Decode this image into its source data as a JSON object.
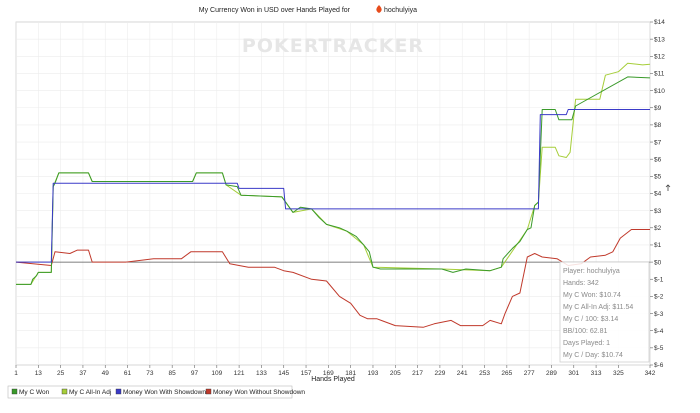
{
  "chart_data": {
    "type": "line",
    "title_text": "My Currency Won in USD over Hands Played for",
    "title_player": "hochulyiya",
    "xlabel": "Hands Played",
    "xlim": [
      1,
      342
    ],
    "xticks": [
      1,
      13,
      25,
      37,
      49,
      61,
      73,
      85,
      97,
      109,
      121,
      133,
      145,
      157,
      169,
      181,
      193,
      205,
      217,
      229,
      241,
      253,
      265,
      277,
      289,
      301,
      313,
      325,
      342
    ],
    "ylim": [
      -6,
      14
    ],
    "yticks": [
      -6,
      -5,
      -4,
      -3,
      -2,
      -1,
      0,
      1,
      2,
      3,
      4,
      5,
      6,
      7,
      8,
      9,
      10,
      11,
      12,
      13,
      14
    ],
    "ytick_labels": [
      "$-6",
      "$-5",
      "$-4",
      "$-3",
      "$-2",
      "$-1",
      "$0",
      "$1",
      "$2",
      "$3",
      "$4",
      "$5",
      "$6",
      "$7",
      "$8",
      "$9",
      "$10",
      "$11",
      "$12",
      "$13",
      "$14"
    ],
    "grid": true,
    "watermark": "POKERTRACKER",
    "series": [
      {
        "name": "My C Won",
        "color": "#3a9a2a",
        "points": [
          [
            1,
            -1.3
          ],
          [
            9,
            -1.3
          ],
          [
            10,
            -1.0
          ],
          [
            12,
            -0.8
          ],
          [
            13,
            -0.6
          ],
          [
            20,
            -0.6
          ],
          [
            21,
            4.4
          ],
          [
            22,
            4.6
          ],
          [
            24,
            5.2
          ],
          [
            40,
            5.2
          ],
          [
            42,
            4.7
          ],
          [
            96,
            4.7
          ],
          [
            98,
            5.2
          ],
          [
            112,
            5.2
          ],
          [
            114,
            4.5
          ],
          [
            120,
            4.4
          ],
          [
            122,
            3.9
          ],
          [
            144,
            3.8
          ],
          [
            146,
            3.5
          ],
          [
            150,
            2.9
          ],
          [
            154,
            3.2
          ],
          [
            160,
            3.1
          ],
          [
            164,
            2.6
          ],
          [
            168,
            2.2
          ],
          [
            175,
            2.0
          ],
          [
            179,
            1.8
          ],
          [
            184,
            1.5
          ],
          [
            188,
            1.0
          ],
          [
            191,
            0.6
          ],
          [
            193,
            -0.3
          ],
          [
            197,
            -0.4
          ],
          [
            230,
            -0.4
          ],
          [
            236,
            -0.6
          ],
          [
            243,
            -0.4
          ],
          [
            256,
            -0.5
          ],
          [
            262,
            -0.3
          ],
          [
            263,
            0.2
          ],
          [
            268,
            0.8
          ],
          [
            272,
            1.2
          ],
          [
            276,
            1.9
          ],
          [
            278,
            2.0
          ],
          [
            280,
            3.3
          ],
          [
            282,
            3.5
          ],
          [
            284,
            8.9
          ],
          [
            291,
            8.9
          ],
          [
            293,
            8.3
          ],
          [
            300,
            8.3
          ],
          [
            302,
            9.1
          ],
          [
            330,
            10.8
          ],
          [
            342,
            10.74
          ]
        ]
      },
      {
        "name": "My C All-In Adj",
        "color": "#a6ce39",
        "points": [
          [
            1,
            -1.3
          ],
          [
            9,
            -1.3
          ],
          [
            13,
            -0.6
          ],
          [
            20,
            -0.6
          ],
          [
            21,
            4.4
          ],
          [
            24,
            5.2
          ],
          [
            40,
            5.2
          ],
          [
            42,
            4.7
          ],
          [
            96,
            4.7
          ],
          [
            98,
            5.2
          ],
          [
            112,
            5.2
          ],
          [
            114,
            4.5
          ],
          [
            122,
            3.9
          ],
          [
            144,
            3.8
          ],
          [
            150,
            2.9
          ],
          [
            160,
            3.1
          ],
          [
            168,
            2.2
          ],
          [
            179,
            1.8
          ],
          [
            188,
            1.0
          ],
          [
            193,
            -0.3
          ],
          [
            230,
            -0.4
          ],
          [
            256,
            -0.5
          ],
          [
            262,
            -0.3
          ],
          [
            276,
            1.9
          ],
          [
            280,
            3.3
          ],
          [
            282,
            3.5
          ],
          [
            284,
            6.7
          ],
          [
            291,
            6.7
          ],
          [
            293,
            6.2
          ],
          [
            297,
            6.1
          ],
          [
            299,
            6.4
          ],
          [
            302,
            9.5
          ],
          [
            315,
            9.5
          ],
          [
            318,
            10.9
          ],
          [
            325,
            11.1
          ],
          [
            330,
            11.6
          ],
          [
            338,
            11.5
          ],
          [
            342,
            11.54
          ]
        ]
      },
      {
        "name": "Money Won With Showdown",
        "color": "#3a3ac8",
        "points": [
          [
            1,
            0
          ],
          [
            20,
            0
          ],
          [
            21,
            4.6
          ],
          [
            120,
            4.6
          ],
          [
            121,
            4.3
          ],
          [
            145,
            4.3
          ],
          [
            146,
            3.1
          ],
          [
            282,
            3.1
          ],
          [
            283,
            8.6
          ],
          [
            297,
            8.6
          ],
          [
            298,
            8.9
          ],
          [
            342,
            8.9
          ]
        ]
      },
      {
        "name": "Money Won Without Showdown",
        "color": "#c0392b",
        "points": [
          [
            1,
            0
          ],
          [
            20,
            -0.2
          ],
          [
            22,
            0.6
          ],
          [
            30,
            0.5
          ],
          [
            34,
            0.7
          ],
          [
            40,
            0.7
          ],
          [
            42,
            0.0
          ],
          [
            60,
            0.0
          ],
          [
            75,
            0.2
          ],
          [
            90,
            0.2
          ],
          [
            95,
            0.6
          ],
          [
            112,
            0.6
          ],
          [
            116,
            -0.1
          ],
          [
            126,
            -0.3
          ],
          [
            140,
            -0.3
          ],
          [
            145,
            -0.5
          ],
          [
            150,
            -0.6
          ],
          [
            160,
            -1.0
          ],
          [
            168,
            -1.1
          ],
          [
            175,
            -2.0
          ],
          [
            181,
            -2.4
          ],
          [
            186,
            -3.1
          ],
          [
            190,
            -3.3
          ],
          [
            195,
            -3.3
          ],
          [
            205,
            -3.7
          ],
          [
            220,
            -3.8
          ],
          [
            226,
            -3.6
          ],
          [
            235,
            -3.4
          ],
          [
            240,
            -3.7
          ],
          [
            252,
            -3.7
          ],
          [
            256,
            -3.4
          ],
          [
            262,
            -3.6
          ],
          [
            264,
            -3.0
          ],
          [
            268,
            -2.0
          ],
          [
            272,
            -1.8
          ],
          [
            276,
            0.3
          ],
          [
            280,
            0.5
          ],
          [
            284,
            0.3
          ],
          [
            292,
            0.2
          ],
          [
            298,
            -0.2
          ],
          [
            305,
            -0.1
          ],
          [
            310,
            0.3
          ],
          [
            318,
            0.4
          ],
          [
            322,
            0.6
          ],
          [
            326,
            1.4
          ],
          [
            332,
            1.9
          ],
          [
            342,
            1.9
          ]
        ]
      }
    ],
    "stats_box": [
      "Player: hochulyiya",
      "Hands: 342",
      "My C Won: $10.74",
      "My C All-In Adj: $11.54",
      "My C / 100: $3.14",
      "BB/100: 62.81",
      "Days Played: 1",
      "My C / Day: $10.74"
    ],
    "legend": [
      {
        "label": "My C Won",
        "color": "#3a9a2a"
      },
      {
        "label": "My C All-In Adj",
        "color": "#a6ce39"
      },
      {
        "label": "Money Won With Showdown",
        "color": "#3a3ac8"
      },
      {
        "label": "Money Won Without Showdown",
        "color": "#c0392b"
      }
    ]
  }
}
